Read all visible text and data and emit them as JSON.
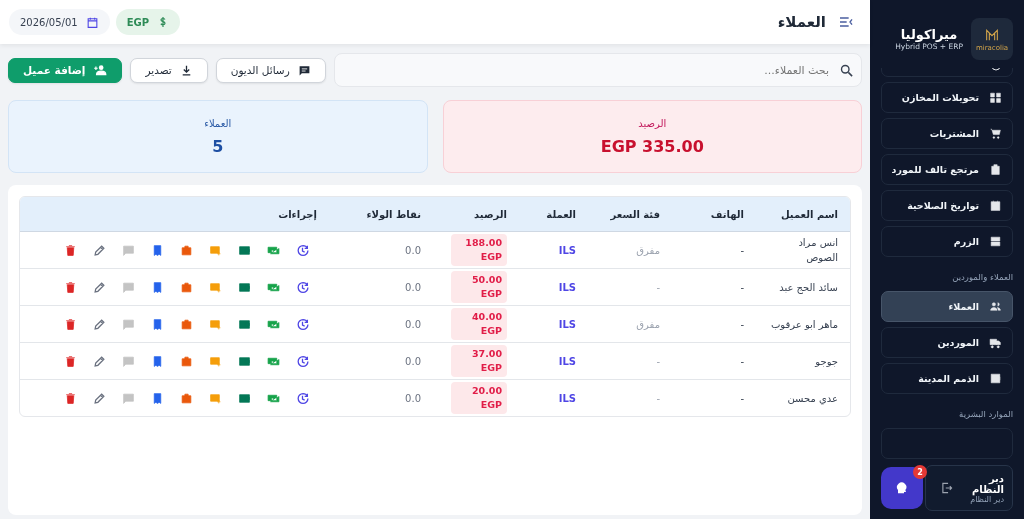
{
  "header": {
    "title": "العملاء",
    "date": "2026/05/01",
    "currency": "EGP"
  },
  "toolbar": {
    "search": {
      "placeholder": "بحث العملاء..."
    },
    "buttons": [
      {
        "kind": "messages",
        "label": "رسائل الديون"
      },
      {
        "kind": "export",
        "label": "تصدير"
      },
      {
        "kind": "add",
        "label": "إضافة عميل"
      }
    ]
  },
  "stats": [
    {
      "kind": "balance",
      "label": "الرصيد",
      "value": "EGP 335.00"
    },
    {
      "kind": "count",
      "label": "العملاء",
      "value": "5"
    }
  ],
  "table": {
    "columns": [
      "اسم العميل",
      "الهاتف",
      "فئة السعر",
      "العملة",
      "الرصيد",
      "نقاط الولاء",
      "إجراءات"
    ],
    "rows": [
      {
        "name": "انس مراد الصوص",
        "phone": "-",
        "price_class": "مفرق",
        "currency": "ILS",
        "balance": "188.00 EGP",
        "loyalty": "0.0"
      },
      {
        "name": "سائد الحج عبد",
        "phone": "-",
        "price_class": "-",
        "currency": "ILS",
        "balance": "50.00 EGP",
        "loyalty": "0.0"
      },
      {
        "name": "ماهر ابو عرقوب",
        "phone": "-",
        "price_class": "مفرق",
        "currency": "ILS",
        "balance": "40.00 EGP",
        "loyalty": "0.0"
      },
      {
        "name": "جوجو",
        "phone": "-",
        "price_class": "-",
        "currency": "ILS",
        "balance": "37.00 EGP",
        "loyalty": "0.0"
      },
      {
        "name": "عدي محسن",
        "phone": "-",
        "price_class": "-",
        "currency": "ILS",
        "balance": "20.00 EGP",
        "loyalty": "0.0"
      }
    ]
  },
  "sidebar": {
    "brand": "ميراكوليا",
    "tagline": "Hybrid POS + ERP",
    "logo_text": "miracolia",
    "items": [
      {
        "kind": "item",
        "label": "تحويلات المخازن",
        "selected": false
      },
      {
        "kind": "item",
        "label": "المشتريات",
        "selected": false
      },
      {
        "kind": "item",
        "label": "مرتجع تالف للمورد",
        "selected": false
      },
      {
        "kind": "item",
        "label": "تواريخ الصلاحية",
        "selected": false
      },
      {
        "kind": "item",
        "label": "الزرم",
        "selected": false
      },
      {
        "kind": "section",
        "label": "العملاء والموردين"
      },
      {
        "kind": "item",
        "label": "العملاء",
        "selected": true
      },
      {
        "kind": "item",
        "label": "الموردين",
        "selected": false
      },
      {
        "kind": "item",
        "label": "الذمم المدينة",
        "selected": false
      },
      {
        "kind": "section",
        "label": "الموارد البشرية"
      }
    ],
    "user": {
      "name": "دير النظام",
      "role": "دير النظام"
    }
  },
  "help": {
    "badge": "2"
  }
}
